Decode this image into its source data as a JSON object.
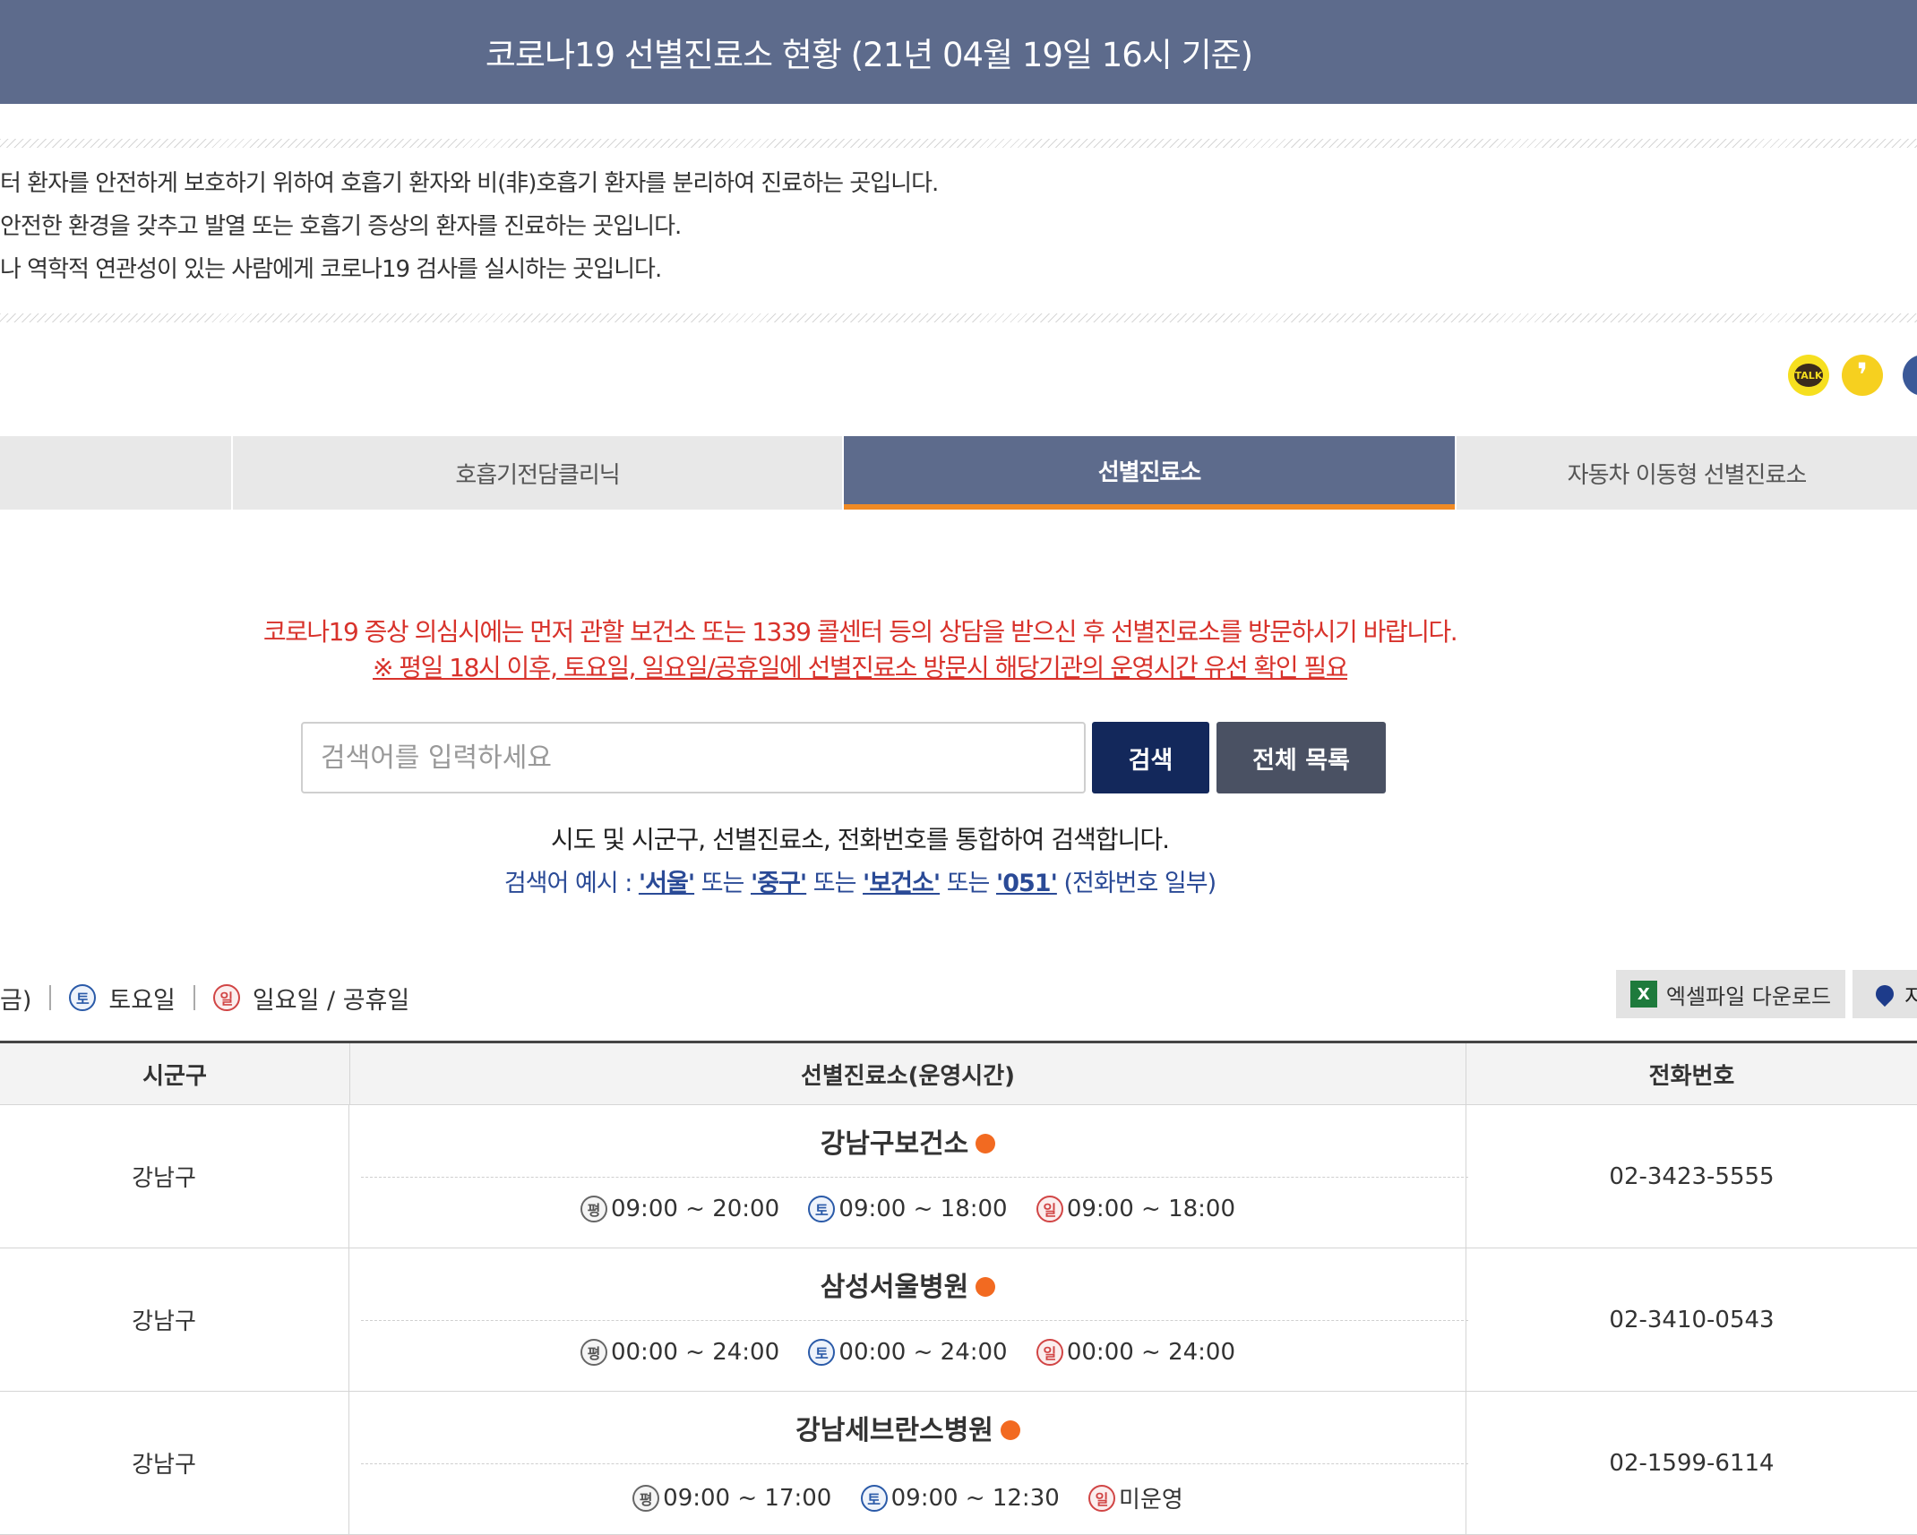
{
  "header": {
    "title": "코로나19 선별진료소 현황 (21년 04월 19일 16시 기준)"
  },
  "description": {
    "lines": [
      "터 환자를 안전하게 보호하기 위하여 호흡기 환자와 비(非)호흡기 환자를 분리하여 진료하는 곳입니다.",
      " 안전한 환경을 갖추고 발열 또는 호흡기 증상의 환자를 진료하는 곳입니다.",
      "나 역학적 연관성이 있는 사람에게 코로나19 검사를 실시하는 곳입니다."
    ]
  },
  "share": {
    "kakaotalk_label": "TALK",
    "kakaostory_label": "❜"
  },
  "tabs": [
    {
      "label": ""
    },
    {
      "label": "호흡기전담클리닉"
    },
    {
      "label": "선별진료소"
    },
    {
      "label": "자동차 이동형 선별진료소"
    }
  ],
  "notice": {
    "line1": "코로나19 증상 의심시에는 먼저 관할 보건소 또는 1339 콜센터 등의 상담을 받으신 후 선별진료소를 방문하시기 바랍니다.",
    "line2": "※ 평일 18시 이후, 토요일, 일요일/공휴일에 선별진료소 방문시 해당기관의 운영시간 유선 확인 필요"
  },
  "search": {
    "placeholder": "검색어를 입력하세요",
    "value": "",
    "search_label": "검색",
    "all_label": "전체 목록"
  },
  "help": {
    "line1": "시도 및 시군구, 선별진료소, 전화번호를 통합하여 검색합니다.",
    "prefix": "검색어 예시 : ",
    "ex1": "'서울'",
    "or1": " 또는 ",
    "ex2": "'중구'",
    "or2": " 또는 ",
    "ex3": "'보건소'",
    "or3": " 또는 ",
    "ex4": "'051'",
    "suffix": " (전화번호 일부)"
  },
  "legend": {
    "weekday_tail": "금)",
    "sat_badge": "토",
    "sat_label": "토요일",
    "sun_badge": "일",
    "sun_label": "일요일 / 공휴일"
  },
  "actions": {
    "excel_icon": "X",
    "excel_label": "엑셀파일 다운로드",
    "map_label": "지"
  },
  "table": {
    "headers": {
      "district": "시군구",
      "clinic": "선별진료소(운영시간)",
      "phone": "전화번호"
    },
    "badges": {
      "weekday": "평",
      "sat": "토",
      "sun": "일"
    },
    "rows": [
      {
        "district": "강남구",
        "name": "강남구보건소",
        "weekday": "09:00 ~ 20:00",
        "sat": "09:00 ~ 18:00",
        "sun": "09:00 ~ 18:00",
        "phone": "02-3423-5555"
      },
      {
        "district": "강남구",
        "name": "삼성서울병원",
        "weekday": "00:00 ~ 24:00",
        "sat": "00:00 ~ 24:00",
        "sun": "00:00 ~ 24:00",
        "phone": "02-3410-0543"
      },
      {
        "district": "강남구",
        "name": "강남세브란스병원",
        "weekday": "09:00 ~ 17:00",
        "sat": "09:00 ~ 12:30",
        "sun": "미운영",
        "phone": "02-1599-6114"
      }
    ]
  },
  "colors": {
    "header_bg": "#5d6b8c",
    "accent_orange": "#f08a24",
    "notice_red": "#d8322b",
    "search_button": "#13285b",
    "all_button": "#4a5163"
  }
}
